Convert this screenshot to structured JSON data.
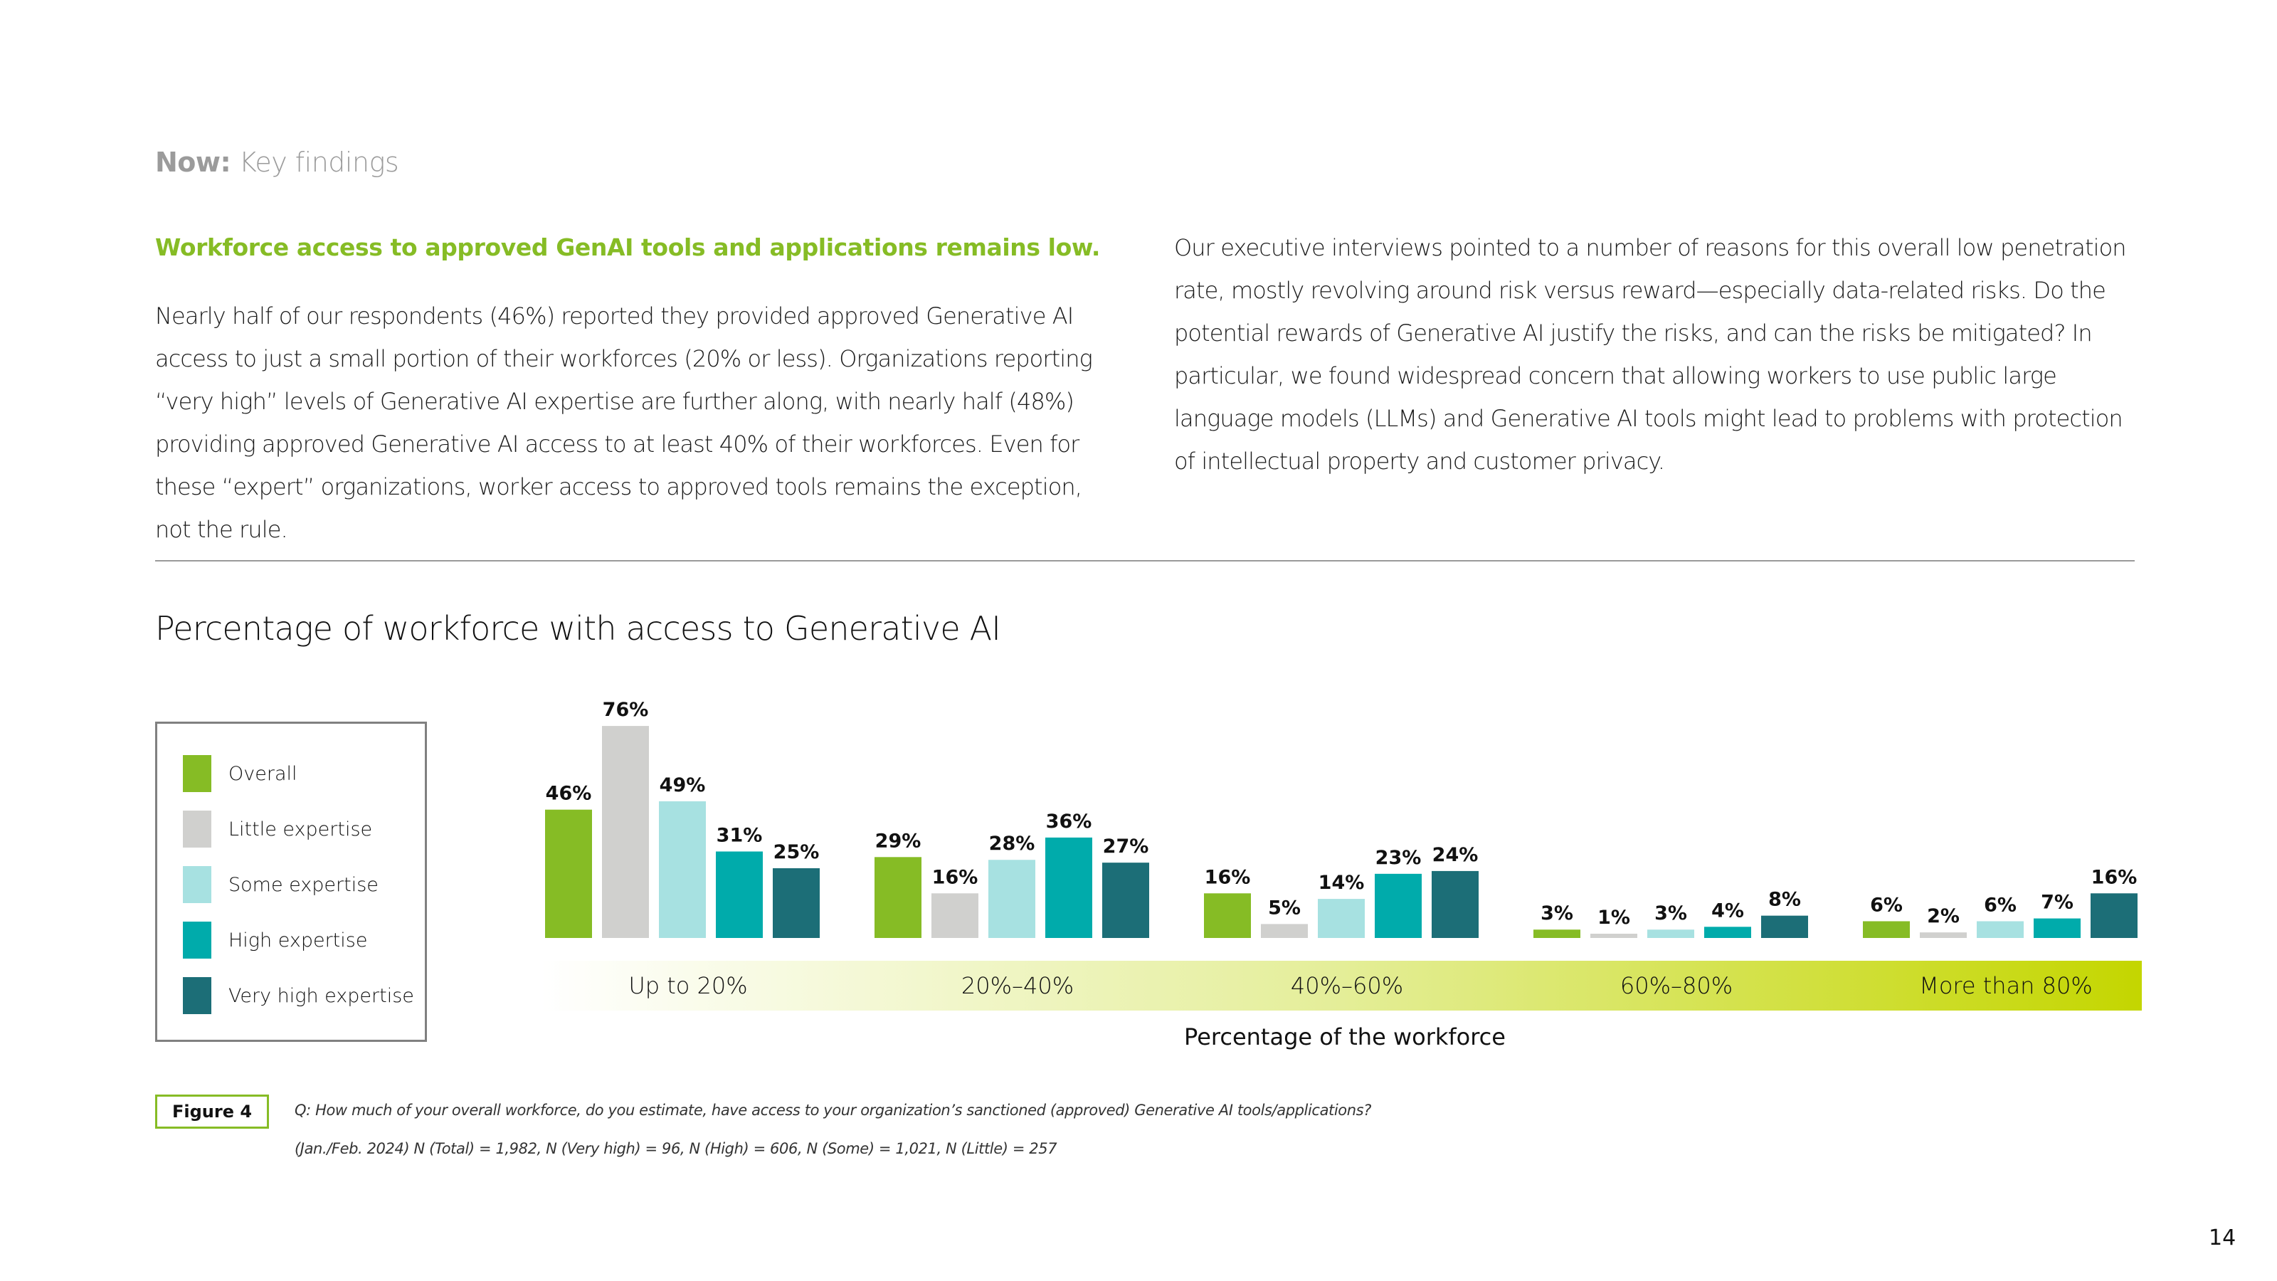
{
  "header": {
    "section_bold": "Now:",
    "section_rest": "Key findings"
  },
  "left_column": {
    "headline": "Workforce access to approved GenAI tools and applications remains low.",
    "body": "Nearly half of our respondents (46%) reported they provided approved Generative AI access to just a small portion of their workforces (20% or less). Organizations reporting “very high” levels of Generative AI expertise are further along, with nearly half (48%) providing approved Generative AI access to at least 40% of their workforces. Even for these “expert” organizations, worker access to approved tools remains the exception, not the rule."
  },
  "right_column": {
    "body": "Our executive interviews pointed to a number of reasons for this overall low penetration rate, mostly revolving around risk versus reward—especially data-related risks. Do the potential rewards of Generative AI justify the risks, and can the risks be mitigated? In particular, we found widespread concern that allowing workers to use public large language models (LLMs) and Generative AI tools might lead to problems with protection of intellectual property and customer privacy."
  },
  "chart_data": {
    "type": "bar",
    "title": "Percentage of workforce with access to Generative AI",
    "xlabel": "Percentage of the workforce",
    "ylabel": "",
    "ylim": [
      0,
      80
    ],
    "grid": false,
    "legend_position": "left",
    "categories": [
      "Up to 20%",
      "20%–40%",
      "40%–60%",
      "60%–80%",
      "More than 80%"
    ],
    "series": [
      {
        "name": "Overall",
        "color": "#86bc25",
        "values": [
          46,
          29,
          16,
          3,
          6
        ]
      },
      {
        "name": "Little expertise",
        "color": "#d0d0ce",
        "values": [
          76,
          16,
          5,
          1,
          2
        ]
      },
      {
        "name": "Some expertise",
        "color": "#a7e1e1",
        "values": [
          49,
          28,
          14,
          3,
          6
        ]
      },
      {
        "name": "High expertise",
        "color": "#00abab",
        "values": [
          31,
          36,
          23,
          4,
          7
        ]
      },
      {
        "name": "Very high expertise",
        "color": "#1c6e77",
        "values": [
          25,
          27,
          24,
          8,
          16
        ]
      }
    ],
    "value_suffix": "%",
    "band_gradient": [
      "#ffffff",
      "#e4ee98",
      "#c4d600"
    ]
  },
  "figure": {
    "label": "Figure 4",
    "question": "Q: How much of your overall workforce, do you estimate, have access to your organization’s sanctioned (approved) Generative AI tools/applications?",
    "sample": "(Jan./Feb. 2024) N (Total) = 1,982, N (Very high) = 96, N (High) = 606, N (Some) = 1,021, N (Little) = 257"
  },
  "page_number": "14"
}
